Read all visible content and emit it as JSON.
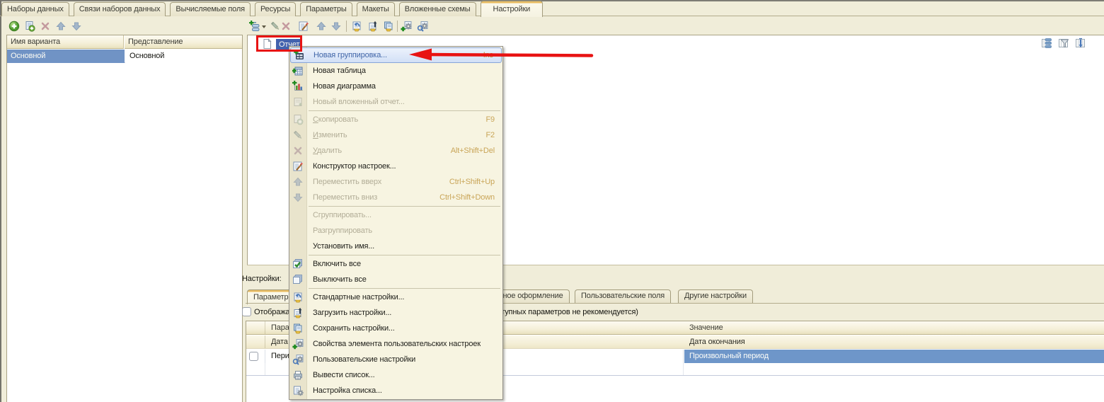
{
  "top_tabs": [
    {
      "label": "Наборы данных",
      "active": false
    },
    {
      "label": "Связи наборов данных",
      "active": false
    },
    {
      "label": "Вычисляемые поля",
      "active": false
    },
    {
      "label": "Ресурсы",
      "active": false
    },
    {
      "label": "Параметры",
      "active": false
    },
    {
      "label": "Макеты",
      "active": false
    },
    {
      "label": "Вложенные схемы",
      "active": false
    },
    {
      "label": "Настройки",
      "active": true
    }
  ],
  "variants_panel": {
    "toolbar": [
      {
        "icon": "add-icon",
        "enabled": true
      },
      {
        "icon": "add-copy-icon",
        "enabled": true
      },
      {
        "icon": "delete-icon",
        "enabled": false
      },
      {
        "icon": "move-up-icon",
        "enabled": false
      },
      {
        "icon": "move-down-icon",
        "enabled": false
      }
    ],
    "columns": [
      "Имя варианта",
      "Представление"
    ],
    "rows": [
      {
        "name": "Основной",
        "presentation": "Основной",
        "selected": true
      }
    ]
  },
  "settings_area": {
    "toolbar": [
      {
        "icon": "add-element-icon",
        "enabled": true,
        "dropdown": true
      },
      {
        "icon": "edit-icon",
        "enabled": false
      },
      {
        "icon": "delete-icon",
        "enabled": false
      },
      {
        "icon": "settings-wizard-icon",
        "enabled": true
      },
      {
        "icon": "move-up-icon",
        "enabled": false
      },
      {
        "icon": "move-down-icon",
        "enabled": false
      },
      {
        "separator": true
      },
      {
        "icon": "standard-settings-icon",
        "enabled": true
      },
      {
        "icon": "load-settings-icon",
        "enabled": true
      },
      {
        "icon": "save-settings-icon",
        "enabled": true
      },
      {
        "separator": true
      },
      {
        "icon": "user-settings-properties-icon",
        "enabled": true
      },
      {
        "icon": "user-settings-icon",
        "enabled": true
      }
    ],
    "tree": {
      "root_label": "Отчет",
      "root_icon": "report-icon",
      "selected": true
    },
    "view_toggles": [
      {
        "icon": "view-structure-icon"
      },
      {
        "icon": "view-filter-icon"
      },
      {
        "icon": "view-order-icon"
      }
    ],
    "bottom": {
      "caption": "Настройки:",
      "tabs": [
        {
          "label": "Параметры",
          "active": true
        },
        {
          "label": "Условное оформление",
          "active": false
        },
        {
          "label": "Пользовательские поля",
          "active": false
        },
        {
          "label": "Другие настройки",
          "active": false
        }
      ],
      "checkbox": {
        "label": "Отображать недоступные параметры (использование значений недоступных параметров не рекомендуется)",
        "checked": false
      },
      "params_table": {
        "columns": [
          "Параметр",
          "Значение"
        ],
        "rows": [
          {
            "parameter": "Дата окончания",
            "value": "Дата окончания",
            "has_checkbox": false,
            "unavailable": true,
            "value_selected": false
          },
          {
            "parameter": "Период",
            "value": "Произвольный период",
            "has_checkbox": true,
            "checked": false,
            "unavailable": false,
            "value_selected": true
          }
        ]
      }
    }
  },
  "context_menu": {
    "items": [
      {
        "label": "Новая группировка...",
        "shortcut": "Ins",
        "icon": "new-grouping-icon",
        "highlighted": true
      },
      {
        "label": "Новая таблица",
        "icon": "new-table-icon"
      },
      {
        "label": "Новая диаграмма",
        "icon": "new-chart-icon"
      },
      {
        "label": "Новый вложенный отчет...",
        "icon": "new-nested-report-icon",
        "disabled": true
      },
      {
        "separator": true
      },
      {
        "label": "Скопировать",
        "shortcut": "F9",
        "icon": "copy-icon",
        "disabled": true,
        "accel": 1
      },
      {
        "label": "Изменить",
        "shortcut": "F2",
        "icon": "edit-icon",
        "disabled": true,
        "accel": 1
      },
      {
        "label": "Удалить",
        "shortcut": "Alt+Shift+Del",
        "icon": "delete-icon",
        "disabled": true,
        "accel": 1
      },
      {
        "label": "Конструктор настроек...",
        "icon": "settings-wizard-icon"
      },
      {
        "label": "Переместить вверх",
        "shortcut": "Ctrl+Shift+Up",
        "icon": "move-up-icon",
        "disabled": true
      },
      {
        "label": "Переместить вниз",
        "shortcut": "Ctrl+Shift+Down",
        "icon": "move-down-icon",
        "disabled": true
      },
      {
        "separator": true
      },
      {
        "label": "Сгруппировать...",
        "disabled": true
      },
      {
        "label": "Разгруппировать",
        "disabled": true
      },
      {
        "label": "Установить имя..."
      },
      {
        "separator": true
      },
      {
        "label": "Включить все",
        "icon": "enable-all-icon"
      },
      {
        "label": "Выключить все",
        "icon": "disable-all-icon"
      },
      {
        "separator": true
      },
      {
        "label": "Стандартные настройки...",
        "icon": "standard-settings-icon"
      },
      {
        "label": "Загрузить настройки...",
        "icon": "load-settings-icon"
      },
      {
        "label": "Сохранить настройки...",
        "icon": "save-settings-icon"
      },
      {
        "label": "Свойства элемента пользовательских настроек",
        "icon": "user-settings-properties-icon"
      },
      {
        "label": "Пользовательские настройки",
        "icon": "user-settings-icon"
      },
      {
        "label": "Вывести список...",
        "icon": "print-list-icon"
      },
      {
        "label": "Настройка списка...",
        "icon": "list-settings-icon"
      }
    ]
  },
  "annotations": {
    "box_around": "Отчет",
    "arrow_points_to": "Новая группировка...",
    "color": "#e81313"
  }
}
